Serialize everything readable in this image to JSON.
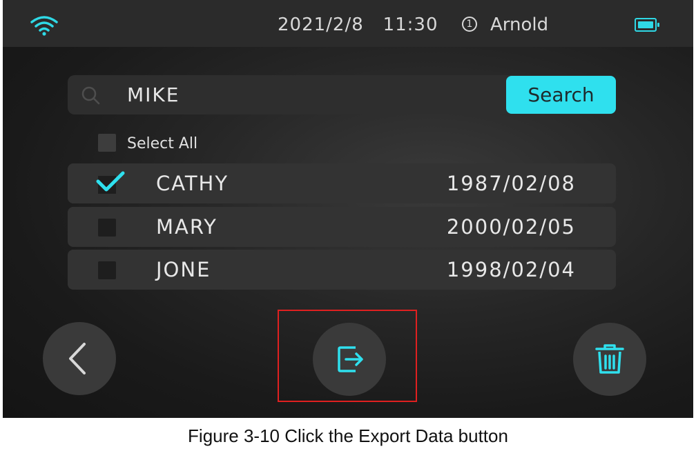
{
  "status_bar": {
    "date": "2021/2/8",
    "time": "11:30",
    "user_badge": "1",
    "username": "Arnold",
    "wifi_icon": "wifi-icon",
    "battery_icon": "battery-icon"
  },
  "search": {
    "value": "MIKE",
    "button_label": "Search",
    "icon": "search-icon"
  },
  "select_all": {
    "label": "Select All",
    "checked": false
  },
  "records": [
    {
      "name": "CATHY",
      "date": "1987/02/08",
      "checked": true
    },
    {
      "name": "MARY",
      "date": "2000/02/05",
      "checked": false
    },
    {
      "name": "JONE",
      "date": "1998/02/04",
      "checked": false
    }
  ],
  "actions": {
    "back_icon": "back-arrow-icon",
    "export_icon": "export-icon",
    "delete_icon": "trash-icon"
  },
  "caption": "Figure 3-10 Click the Export Data button",
  "colors": {
    "accent": "#2fe0ee",
    "highlight": "#e02020",
    "status_bar": "#2b2b2b",
    "row_bg": "#333333"
  }
}
